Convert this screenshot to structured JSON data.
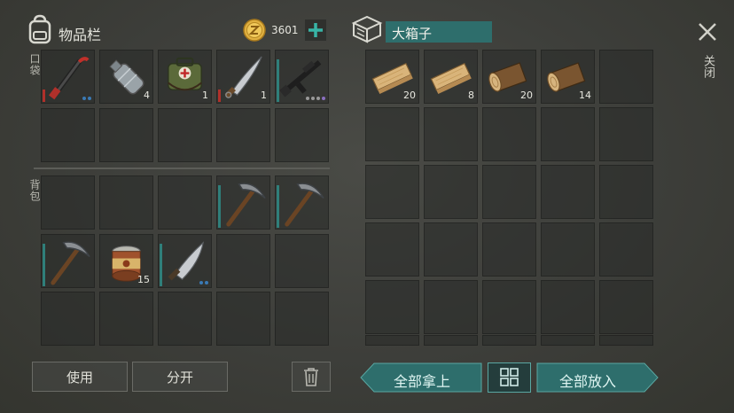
{
  "inventory": {
    "title": "物品栏",
    "coins": "3601",
    "pocket_label": "口袋",
    "backpack_label": "背包",
    "pocket_slots": [
      {
        "item": "crowbar",
        "count": "",
        "durability": "red",
        "dots": [
          "#3a7ab5",
          "#3a7ab5"
        ]
      },
      {
        "item": "water-bottle",
        "count": "4"
      },
      {
        "item": "first-aid-kit",
        "count": "1"
      },
      {
        "item": "machete-sword",
        "count": "1",
        "durability": "red"
      },
      {
        "item": "rifle",
        "count": "",
        "durability": "teal",
        "dots": [
          "#9a9a9a",
          "#9a9a9a",
          "#9a9a9a",
          "#8a6fbf"
        ]
      },
      {},
      {},
      {},
      {},
      {}
    ],
    "backpack_slots": [
      {},
      {},
      {},
      {
        "item": "pickaxe",
        "count": "",
        "durability": "teal"
      },
      {
        "item": "pickaxe",
        "count": "",
        "durability": "teal"
      },
      {
        "item": "pickaxe",
        "count": "",
        "durability": "teal"
      },
      {
        "item": "canned-food",
        "count": "15"
      },
      {
        "item": "machete",
        "count": "",
        "durability": "teal",
        "dots": [
          "#3a7ab5",
          "#3a7ab5"
        ]
      },
      {},
      {},
      {},
      {},
      {},
      {},
      {}
    ]
  },
  "container": {
    "title": "大箱子",
    "slots": [
      {
        "item": "plank",
        "count": "20"
      },
      {
        "item": "plank",
        "count": "8"
      },
      {
        "item": "log",
        "count": "20"
      },
      {
        "item": "log",
        "count": "14"
      }
    ]
  },
  "close_label": "关闭",
  "buttons": {
    "use": "使用",
    "split": "分开",
    "take_all": "全部拿上",
    "put_all": "全部放入"
  },
  "colors": {
    "accent_teal": "#2e6e6c",
    "durability_red": "#b0302a",
    "durability_teal": "#2f7f7a",
    "coin_gold": "#d9a93a"
  }
}
